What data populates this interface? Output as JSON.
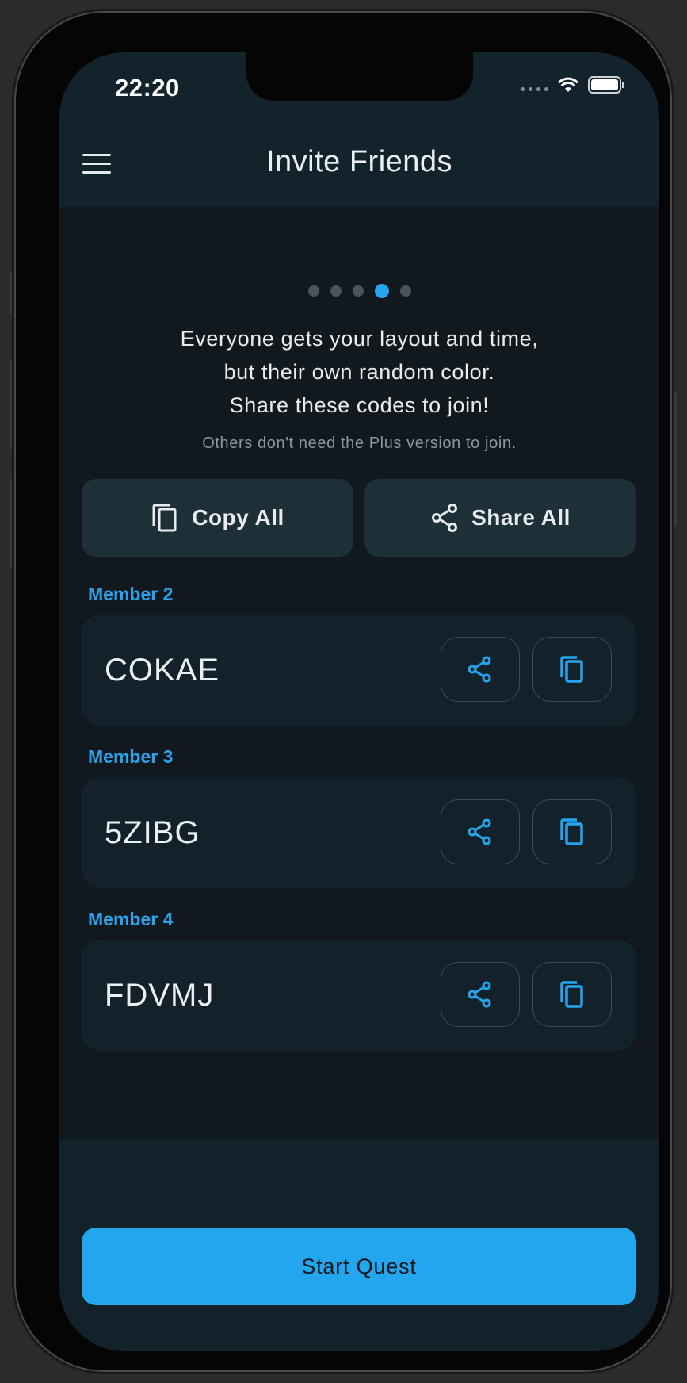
{
  "status_bar": {
    "time": "22:20"
  },
  "appbar": {
    "title": "Invite Friends",
    "menu_icon": "hamburger-menu-icon"
  },
  "pager": {
    "count": 5,
    "active_index": 3
  },
  "intro": {
    "line1": "Everyone gets your layout and time,",
    "line2": "but their own random color.",
    "line3": "Share these codes to join!",
    "note": "Others don't need the Plus version to join."
  },
  "actions": {
    "copy_all_label": "Copy All",
    "share_all_label": "Share All"
  },
  "members": [
    {
      "label": "Member 2",
      "code": "COKAE"
    },
    {
      "label": "Member 3",
      "code": "5ZIBG"
    },
    {
      "label": "Member 4",
      "code": "FDVMJ"
    }
  ],
  "footer": {
    "start_label": "Start Quest"
  },
  "colors": {
    "accent": "#24a6ee",
    "background": "#11191f",
    "surface": "#13222a",
    "button_surface": "#1d2f37"
  }
}
